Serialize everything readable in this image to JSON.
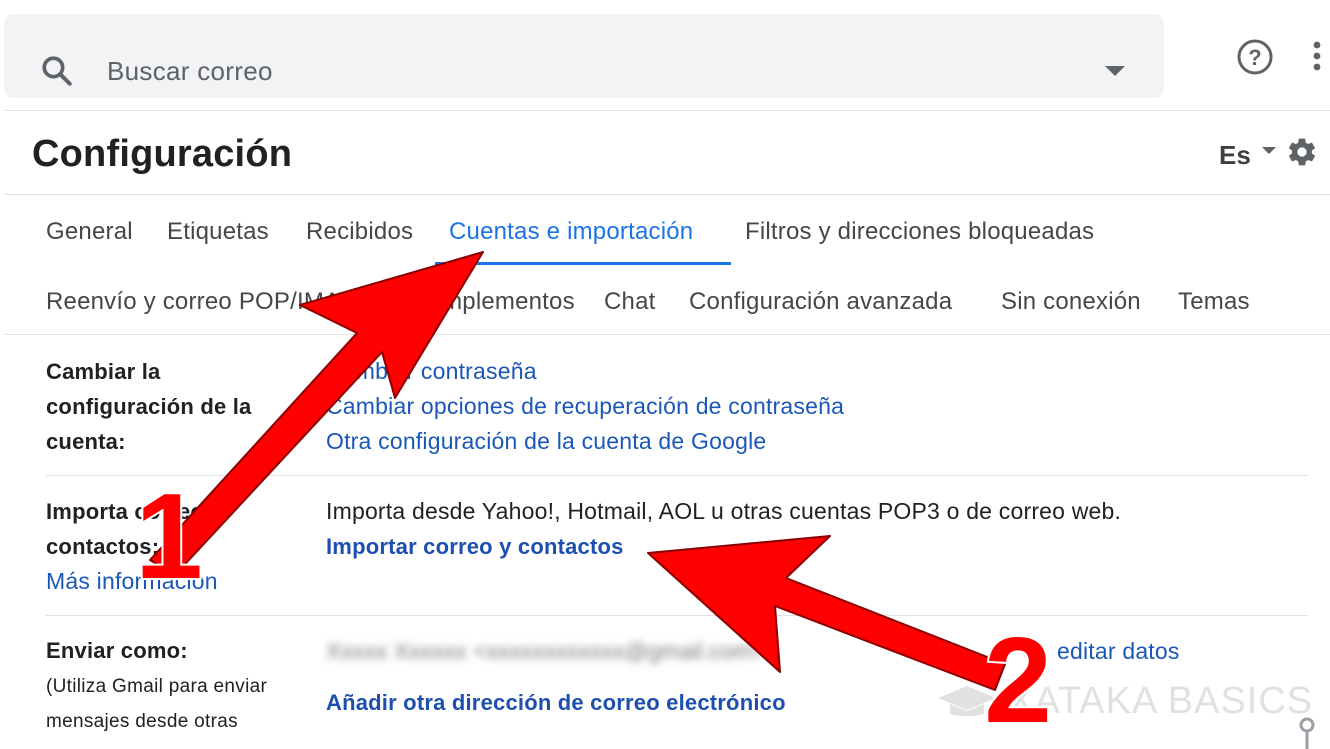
{
  "search": {
    "placeholder": "Buscar correo"
  },
  "header": {
    "title": "Configuración",
    "language": "Es"
  },
  "tabs": [
    {
      "label": "General",
      "active": false
    },
    {
      "label": "Etiquetas",
      "active": false
    },
    {
      "label": "Recibidos",
      "active": false
    },
    {
      "label": "Cuentas e importación",
      "active": true
    },
    {
      "label": "Filtros y direcciones bloqueadas",
      "active": false
    },
    {
      "label": "Reenvío y correo POP/IMAP",
      "active": false
    },
    {
      "label": "Complementos",
      "active": false
    },
    {
      "label": "Chat",
      "active": false
    },
    {
      "label": "Configuración avanzada",
      "active": false
    },
    {
      "label": "Sin conexión",
      "active": false
    },
    {
      "label": "Temas",
      "active": false
    }
  ],
  "sections": {
    "account": {
      "label_lines": [
        "Cambiar la",
        "configuración de la",
        "cuenta:"
      ],
      "links": [
        "Cambiar contraseña",
        "Cambiar opciones de recuperación de contraseña",
        "Otra configuración de la cuenta de Google"
      ]
    },
    "import": {
      "label_lines": [
        "Importa correo y",
        "contactos:"
      ],
      "more_info": "Más información",
      "description": "Importa desde Yahoo!, Hotmail, AOL u otras cuentas POP3 o de correo web.",
      "action": "Importar correo y contactos"
    },
    "send_as": {
      "label": "Enviar como:",
      "sublabel_lines": [
        "(Utiliza Gmail para enviar",
        "mensajes desde otras"
      ],
      "email": "Xxxxx Xxxxxx <xxxxxxxxxxxx@gmail.com>",
      "edit": "editar datos",
      "add": "Añadir otra dirección de correo electrónico"
    }
  },
  "annotations": {
    "arrow_1": "1",
    "arrow_2": "2",
    "arrow_color": "#ff0000"
  },
  "watermark": {
    "text": "XATAKA BASICS"
  },
  "colors": {
    "accent": "#1a73e8",
    "link": "#1a57b8",
    "search_bg": "#f1f3f4"
  }
}
